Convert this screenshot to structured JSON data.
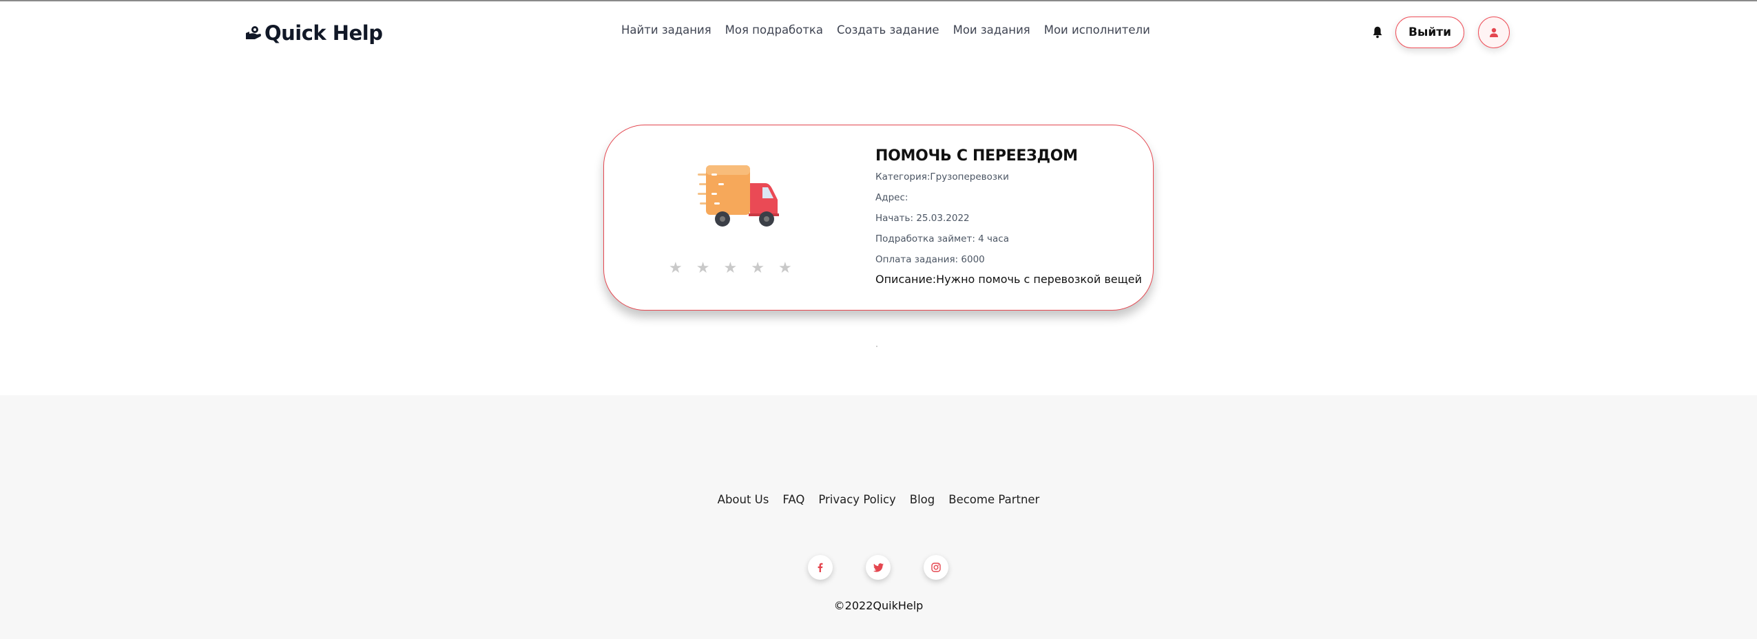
{
  "app": {
    "logo_text": "Quick Help"
  },
  "nav": {
    "items": [
      {
        "label": "Найти задания"
      },
      {
        "label": "Моя подработка"
      },
      {
        "label": "Создать задание"
      },
      {
        "label": "Мои задания"
      },
      {
        "label": "Мои исполнители"
      }
    ]
  },
  "header": {
    "logout_label": "Выйти",
    "bell_icon": "bell-icon",
    "avatar_icon": "user-icon"
  },
  "task": {
    "title": "ПОМОЧЬ С ПЕРЕЕЗДОМ",
    "category": "Категория:Грузоперевозки",
    "address": "Адрес:",
    "start": "Начать: 25.03.2022",
    "duration": "Подработка займет: 4 часа",
    "payment": "Оплата задания: 6000",
    "description": "Описание:Нужно помочь с перевозкой вещей",
    "image_icon": "delivery-truck-icon",
    "rating": {
      "value": 0,
      "max": 5
    }
  },
  "footer": {
    "links": [
      {
        "label": "About Us"
      },
      {
        "label": "FAQ"
      },
      {
        "label": "Privacy Policy"
      },
      {
        "label": "Blog"
      },
      {
        "label": "Become Partner"
      }
    ],
    "socials": [
      "facebook-icon",
      "twitter-icon",
      "instagram-icon"
    ],
    "copyright": "©2022QuikHelp"
  },
  "colors": {
    "accent": "#e4464f",
    "text": "#111827",
    "footer_bg": "#f7f7f7",
    "star_empty": "#c9c9c9"
  }
}
